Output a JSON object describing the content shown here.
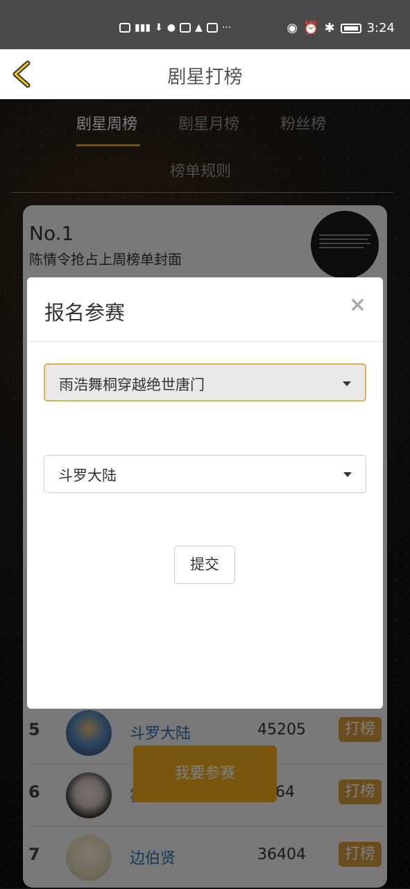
{
  "status_bar": {
    "left_icons": [
      "hd-icon",
      "signal-4g-icon",
      "download-icon",
      "wechat-icon",
      "app-icon",
      "qq-icon",
      "sogou-icon"
    ],
    "more": "···",
    "right_icons": [
      "eye-icon",
      "alarm-icon",
      "bluetooth-icon",
      "battery-icon"
    ],
    "time": "3:24"
  },
  "nav": {
    "title": "剧星打榜"
  },
  "tabs": [
    {
      "label": "剧星周榜",
      "active": true
    },
    {
      "label": "剧星月榜",
      "active": false
    },
    {
      "label": "粉丝榜",
      "active": false
    },
    {
      "label": "榜单规则",
      "active": false
    }
  ],
  "colors": {
    "accent": "#d5a640",
    "button": "#d59a3a",
    "join": "#f0ad1a",
    "link": "#2d6fb3"
  },
  "top_card": {
    "rank": "No.1",
    "subtitle": "陈情令抢占上周榜单封面"
  },
  "rows": [
    {
      "rank": "5",
      "name": "斗罗大陆",
      "score": "45205",
      "button": "打榜"
    },
    {
      "rank": "6",
      "name": "雾",
      "score": "764",
      "button": "打榜"
    },
    {
      "rank": "7",
      "name": "边伯贤",
      "score": "36404",
      "button": "打榜"
    }
  ],
  "join_button": "我要参赛",
  "modal": {
    "title": "报名参赛",
    "close": "×",
    "select1": "雨浩舞桐穿越绝世唐门",
    "select2": "斗罗大陆",
    "submit": "提交"
  }
}
